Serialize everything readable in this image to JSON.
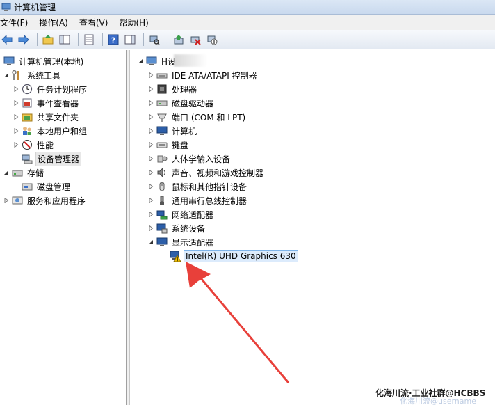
{
  "window": {
    "title": "计算机管理"
  },
  "menu": [
    "文件(F)",
    "操作(A)",
    "查看(V)",
    "帮助(H)"
  ],
  "left_tree": [
    {
      "label": "计算机管理(本地)",
      "level": 0,
      "expander": "none",
      "icon": "computer-management-icon"
    },
    {
      "label": "系统工具",
      "level": 1,
      "expander": "expanded",
      "icon": "tools-icon"
    },
    {
      "label": "任务计划程序",
      "level": 2,
      "expander": "collapsed",
      "icon": "clock-icon"
    },
    {
      "label": "事件查看器",
      "level": 2,
      "expander": "collapsed",
      "icon": "event-viewer-icon"
    },
    {
      "label": "共享文件夹",
      "level": 2,
      "expander": "collapsed",
      "icon": "shared-folder-icon"
    },
    {
      "label": "本地用户和组",
      "level": 2,
      "expander": "collapsed",
      "icon": "users-icon"
    },
    {
      "label": "性能",
      "level": 2,
      "expander": "collapsed",
      "icon": "performance-icon"
    },
    {
      "label": "设备管理器",
      "level": 2,
      "expander": "none",
      "icon": "device-manager-icon",
      "selected": true
    },
    {
      "label": "存储",
      "level": 1,
      "expander": "expanded",
      "icon": "storage-icon"
    },
    {
      "label": "磁盘管理",
      "level": 2,
      "expander": "none",
      "icon": "disk-management-icon"
    },
    {
      "label": "服务和应用程序",
      "level": 1,
      "expander": "collapsed",
      "icon": "services-icon"
    }
  ],
  "device_root": {
    "label": "H设"
  },
  "devices": [
    {
      "label": "IDE ATA/ATAPI 控制器",
      "expander": "collapsed",
      "icon": "ide-controller-icon"
    },
    {
      "label": "处理器",
      "expander": "collapsed",
      "icon": "processor-icon"
    },
    {
      "label": "磁盘驱动器",
      "expander": "collapsed",
      "icon": "disk-drive-icon"
    },
    {
      "label": "端口 (COM 和 LPT)",
      "expander": "collapsed",
      "icon": "port-icon"
    },
    {
      "label": "计算机",
      "expander": "collapsed",
      "icon": "computer-icon"
    },
    {
      "label": "键盘",
      "expander": "collapsed",
      "icon": "keyboard-icon"
    },
    {
      "label": "人体学输入设备",
      "expander": "collapsed",
      "icon": "hid-icon"
    },
    {
      "label": "声音、视频和游戏控制器",
      "expander": "collapsed",
      "icon": "sound-icon"
    },
    {
      "label": "鼠标和其他指针设备",
      "expander": "collapsed",
      "icon": "mouse-icon"
    },
    {
      "label": "通用串行总线控制器",
      "expander": "collapsed",
      "icon": "usb-icon"
    },
    {
      "label": "网络适配器",
      "expander": "collapsed",
      "icon": "network-adapter-icon"
    },
    {
      "label": "系统设备",
      "expander": "collapsed",
      "icon": "system-device-icon"
    },
    {
      "label": "显示适配器",
      "expander": "expanded",
      "icon": "display-adapter-icon"
    }
  ],
  "child_device": {
    "label": "Intel(R) UHD Graphics 630",
    "icon": "warning-display-icon",
    "status": "warning"
  },
  "watermark": {
    "text": "化海川流·工业社群@HCBBS",
    "faint": "化海川流@username"
  },
  "colors": {
    "arrow": "#e8403a",
    "selection": "#dcebfc",
    "selection_border": "#7eb4ea",
    "warning": "#f2c200"
  }
}
